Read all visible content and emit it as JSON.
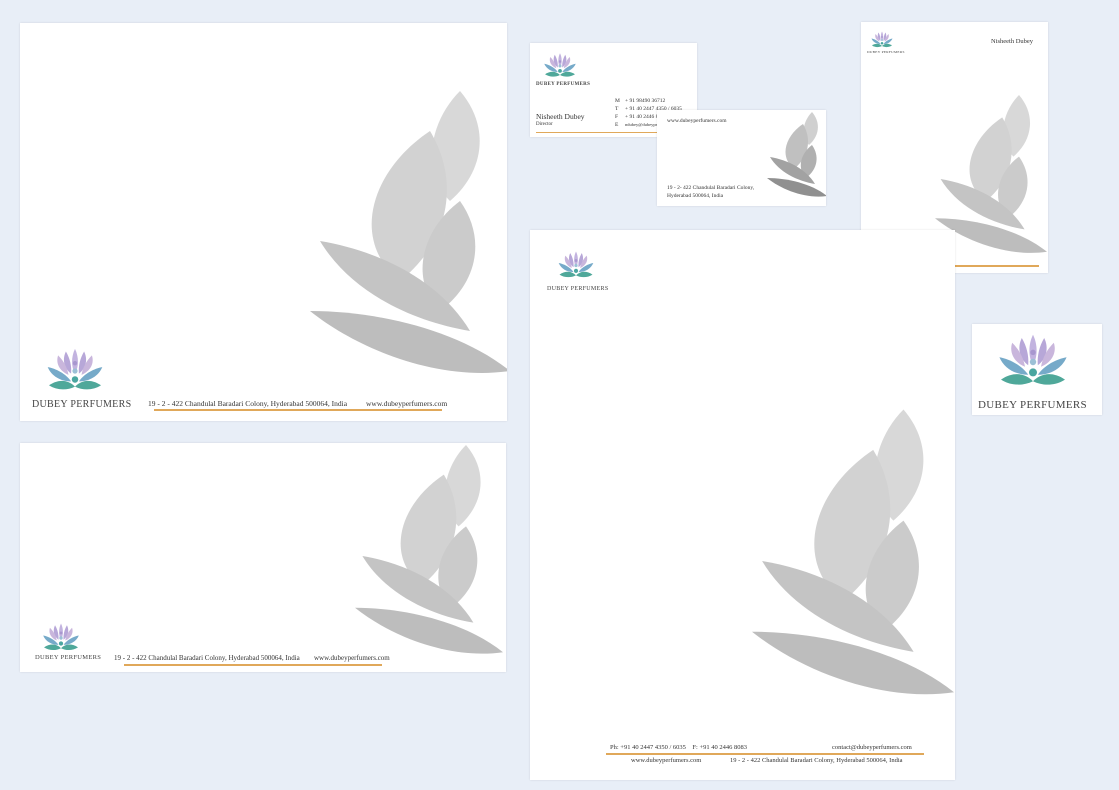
{
  "brand_name": "DUBEY PERFUMERS",
  "address_line": "19 - 2 - 422 Chandulal Baradari Colony, Hyderabad 500064, India",
  "website": "www.dubeyperfumers.com",
  "card_front": {
    "person_name": "Nisheeth Dubey",
    "person_title": "Director",
    "contacts": [
      {
        "label": "M",
        "value": "+ 91 98490 36712"
      },
      {
        "label": "T",
        "value": "+ 91 40 2447 4350 / 6035"
      },
      {
        "label": "F",
        "value": "+ 91 40 2446 8083"
      },
      {
        "label": "E",
        "value": "ndubey@dubeyperfumers.com"
      }
    ]
  },
  "card_back": {
    "website": "www.dubeyperfumers.com",
    "address_line1": "19 - 2- 422 Chandulal Baradari Colony,",
    "address_line2": "Hyderabad 500064, India"
  },
  "compliment_slip": {
    "header_name": "Nisheeth Dubey"
  },
  "letterhead": {
    "phone_line": "Ph: +91 40 2447 4350 / 6035    F: +91 40 2446 8083",
    "email": "contact@dubeyperfumers.com",
    "website": "www.dubeyperfumers.com",
    "address": "19 - 2 - 422 Chandulal Baradari Colony, Hyderabad 500064, India"
  },
  "colors": {
    "background": "#e8eef7",
    "accent_rule": "#e0a85a",
    "lotus_purple": "#b9a6d6",
    "lotus_teal": "#4aa6a0",
    "lotus_blue": "#6fa6c8",
    "leaf_grey": "#cfcfcf"
  }
}
